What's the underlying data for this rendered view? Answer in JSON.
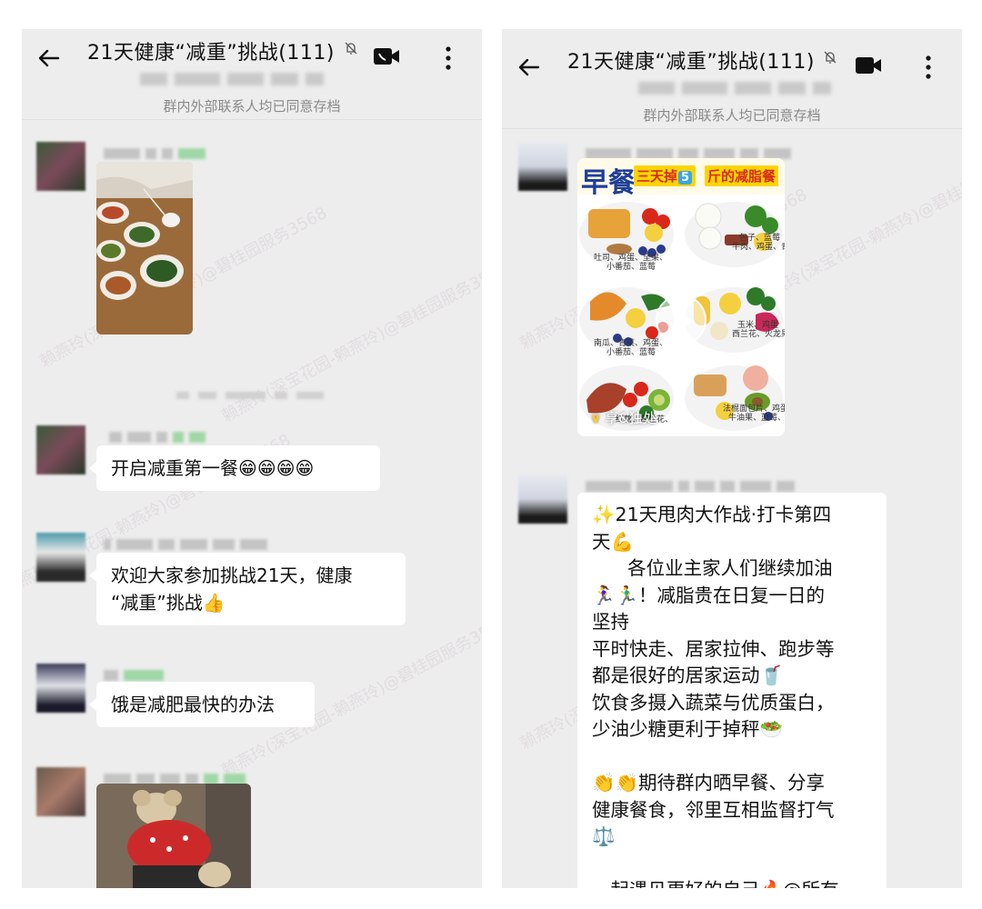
{
  "left": {
    "header": {
      "title": "21天健康“减重”挑战(111)",
      "archive_note": "群内外部联系人均已同意存档"
    },
    "messages": [
      {
        "type": "image",
        "content": "photo of dishes on a dining table"
      },
      {
        "type": "text",
        "text": "开启减重第一餐😁😁😁😁"
      },
      {
        "type": "text",
        "text": "欢迎大家参加挑战21天，健康\n“减重”挑战👍"
      },
      {
        "type": "text",
        "text": "饿是减肥最快的办法"
      },
      {
        "type": "image",
        "content": "photo of a plush teddy bear in red clothes"
      }
    ]
  },
  "right": {
    "header": {
      "title": "21天健康“减重”挑战(111)",
      "archive_note": "群内外部联系人均已同意存档"
    },
    "video_card": {
      "title_main": "早餐",
      "title_tag": "三天掉",
      "title_num": "5",
      "title_rest": "斤的减脂餐",
      "brand": "享&独处",
      "labels": [
        "吐司、鸡蛋、坚果、",
        "小番茄、蓝莓",
        "包子、蓝莓",
        "牛肉、鸡蛋、青",
        "南瓜、青菜、鸡蛋、",
        "小番茄、蓝莓",
        "玉米、鸡蛋",
        "西兰花、火龙果、腰",
        "红薯、西兰花、",
        "法棍面包片、鸡蛋",
        "牛油果、蓝莓、"
      ]
    },
    "message_lines": [
      "✨21天甩肉大作战·打卡第四",
      "天💪",
      "      各位业主家人们继续加油",
      "🏃‍♀️🏃‍♂️！减脂贵在日复一日的",
      "坚持",
      "平时快走、居家拉伸、跑步等",
      "都是很好的居家运动🥤",
      "饮食多摄入蔬菜与优质蛋白，",
      "少油少糖更利于掉秤🥗",
      "",
      "👏👏期待群内晒早餐、分享",
      "健康餐食，邻里互相监督打气",
      "⚖️",
      "",
      "一起遇见更好的自己🔥@所有"
    ]
  },
  "watermark_text": "赖燕玲(深宝花园-赖燕玲)@碧桂园服务3568",
  "colors": {
    "chat_bg": "#ededed",
    "bubble_bg": "#ffffff",
    "note_text": "#8a8a8a"
  }
}
